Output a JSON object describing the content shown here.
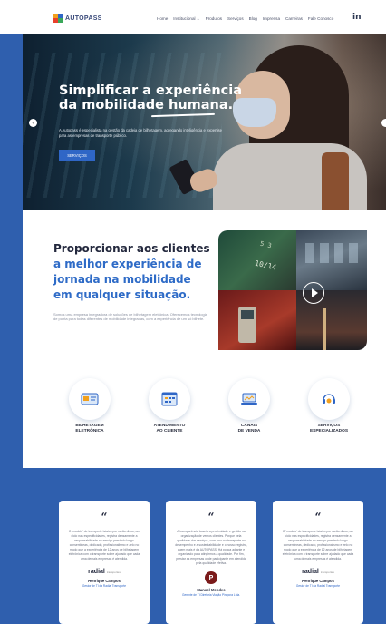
{
  "header": {
    "logo_text": "AUTOPASS",
    "nav": [
      "Home",
      "Institucional ⌄",
      "Produtos",
      "Serviços",
      "Blog",
      "Imprensa",
      "Carreiras",
      "Fale Conosco"
    ],
    "linkedin": "in"
  },
  "hero": {
    "title_line1": "Simplificar a experiência",
    "title_line2": "da mobilidade humana.",
    "subtitle": "A Autopass é especialista na gestão da cadeia de bilhetagem, agregando inteligência e expertise para as empresas de transporte público.",
    "button": "SERVIÇOS",
    "prev_arrow": "‹"
  },
  "mission": {
    "line1": "Proporcionar aos clientes",
    "line2": "a melhor experiência de",
    "line3": "jornada na mobilidade",
    "line4": "em qualquer situação.",
    "text": "Somos uma empresa integradora de soluções de bilhetagem eletrônica. Oferecemos tecnologia de ponta para todas diferentes de mobilidade integradas, com a experiência de um só bilhete.",
    "card_text1": "5 3",
    "card_text2": "10/14"
  },
  "services": [
    {
      "label": "BILHETAGEM\nELETRÔNICA",
      "icon": "ticket-icon"
    },
    {
      "label": "ATENDIMENTO\nAO CLIENTE",
      "icon": "calendar-icon"
    },
    {
      "label": "CANAIS\nDE VENDA",
      "icon": "laptop-icon"
    },
    {
      "label": "SERVIÇOS\nESPECIALIZADOS",
      "icon": "headset-icon"
    }
  ],
  "testimonials": [
    {
      "quote": "“",
      "text": "O 'modelo' de transporte básico por razão disso, um ciclo nas especificidades, registra densamente a responsabilidade no serviço prestado longo consentineas, dedicado, profissionalismo e zelo no modo que a experiência de 12 anos de bilhetagem eletrônica com o transporte sobre ajudado que cada uma demais empresas é atendida.",
      "logo": "radial",
      "logo_small": "transportes",
      "name": "Henrique Campos",
      "role": "Gestor de TI da Radial Transporte"
    },
    {
      "quote": "“",
      "text": "A transparência baseia a proximidade e gestão na organização de vemos clientes. Porque pela qualidade dos serviços, com foco no transporte no desempenho e a sustentabilidade e o nosso registro, quem mais é da AUTOPASS. Há pouca adiante e organizado para atingirmos a qualidade. Por fim, prestar as empresas onde participante em atendida pela qualidade efetiva.",
      "logo": "P",
      "name": "Manoel Mendes",
      "role": "Gerente de TI Diretoria Viação Pirapora Ltda."
    },
    {
      "quote": "“",
      "text": "O 'modelo' de transporte básico por razão disso, um ciclo nas especificidades, registra densamente a responsabilidade no serviço prestado longo consentineas, dedicado, profissionalismo e zelo no modo que a experiência de 12 anos de bilhetagem eletrônica com o transporte sobre ajudado que cada uma demais empresas é atendida.",
      "logo": "radial",
      "logo_small": "transportes",
      "name": "Henrique Campos",
      "role": "Gestor de TI da Radial Transporte"
    }
  ],
  "colors": {
    "accent": "#2f66c6",
    "dark_text": "#23283d",
    "blue_section": "#2f5fae"
  }
}
